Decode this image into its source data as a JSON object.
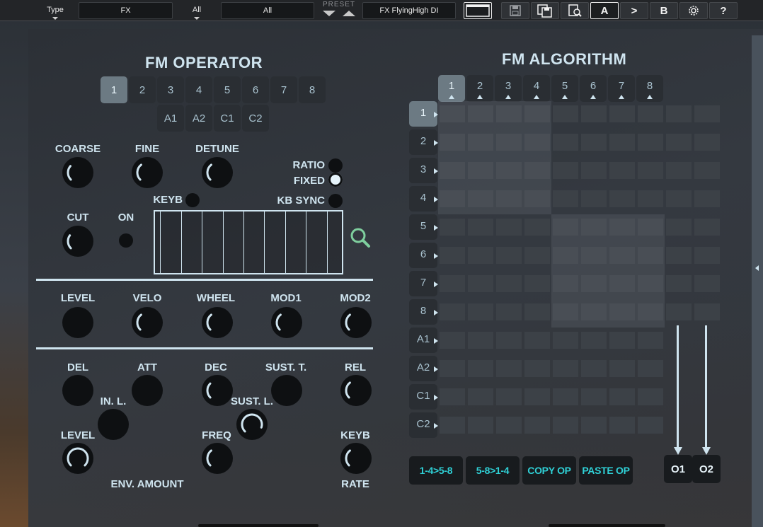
{
  "toolbar": {
    "type_label": "Type",
    "fx_field": "FX",
    "all_label": "All",
    "all_field": "All",
    "preset_label": "PRESET",
    "preset_name": "FX FlyingHigh DI",
    "compare_a": "A",
    "copy_arrow": ">",
    "compare_b": "B",
    "help": "?"
  },
  "operator": {
    "title": "FM OPERATOR",
    "ops": [
      "1",
      "2",
      "3",
      "4",
      "5",
      "6",
      "7",
      "8"
    ],
    "selected_op": "1",
    "extra_ops": [
      "A1",
      "A2",
      "C1",
      "C2"
    ],
    "coarse": "COARSE",
    "fine": "FINE",
    "detune": "DETUNE",
    "ratio": "RATIO",
    "fixed": "FIXED",
    "keyb": "KEYB",
    "kb_sync": "KB SYNC",
    "cut": "CUT",
    "on": "ON",
    "level": "LEVEL",
    "velo": "VELO",
    "wheel": "WHEEL",
    "mod1": "MOD1",
    "mod2": "MOD2",
    "del": "DEL",
    "att": "ATT",
    "dec": "DEC",
    "sust_t": "SUST. T.",
    "rel": "REL",
    "in_l": "IN. L.",
    "sust_l": "SUST. L.",
    "env_level": "LEVEL",
    "freq": "FREQ",
    "env_keyb": "KEYB",
    "env_amount": "ENV. AMOUNT",
    "rate": "RATE"
  },
  "algorithm": {
    "title": "FM ALGORITHM",
    "columns": [
      "1",
      "2",
      "3",
      "4",
      "5",
      "6",
      "7",
      "8"
    ],
    "rows": [
      "1",
      "2",
      "3",
      "4",
      "5",
      "6",
      "7",
      "8",
      "A1",
      "A2",
      "C1",
      "C2"
    ],
    "selected_column": "1",
    "selected_row": "1",
    "actions": [
      "1-4>5-8",
      "5-8>1-4",
      "COPY OP",
      "PASTE OP"
    ],
    "outputs": [
      "O1",
      "O2"
    ]
  }
}
